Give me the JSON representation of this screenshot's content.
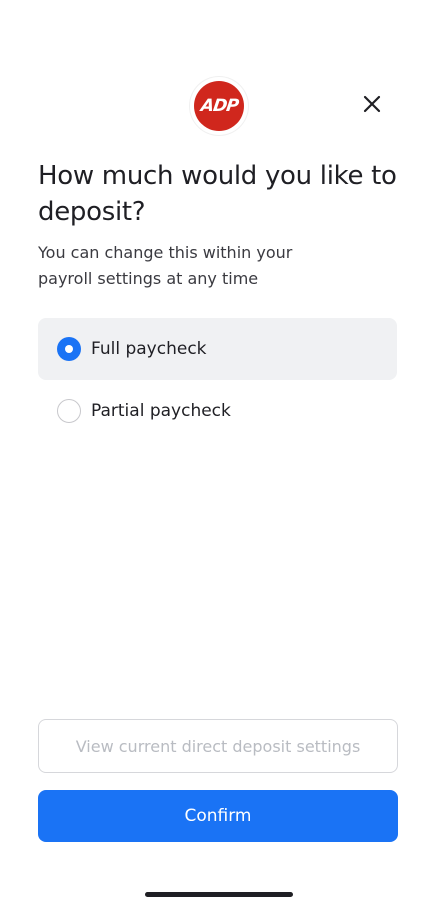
{
  "header": {
    "logo_text": "ADP",
    "close_icon": "close-icon"
  },
  "heading": "How much would you like to deposit?",
  "subtext": "You can change this within your payroll settings at any time",
  "options": [
    {
      "label": "Full paycheck",
      "selected": true
    },
    {
      "label": "Partial paycheck",
      "selected": false
    }
  ],
  "buttons": {
    "secondary_label": "View current direct deposit settings",
    "primary_label": "Confirm"
  },
  "colors": {
    "accent": "#1a73f5",
    "brand": "#d0271d",
    "selected_bg": "#f0f1f3"
  }
}
